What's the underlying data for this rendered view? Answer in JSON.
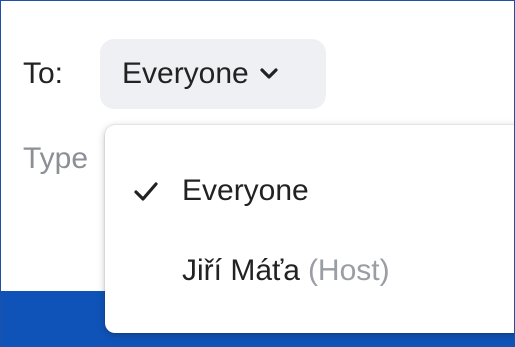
{
  "chat": {
    "to_label": "To:",
    "recipient_selected": "Everyone",
    "message_placeholder": "Type"
  },
  "recipient_menu": {
    "items": [
      {
        "label": "Everyone",
        "tag": "",
        "checked": true
      },
      {
        "label": "Jiří Máťa",
        "tag": "(Host)",
        "checked": false
      }
    ]
  },
  "icons": {
    "dropdown": "chevron-down-icon",
    "selected": "check-icon"
  },
  "colors": {
    "accent_bar": "#0f53b8",
    "select_bg": "#eef0f4",
    "muted_text": "#9a9da3"
  }
}
